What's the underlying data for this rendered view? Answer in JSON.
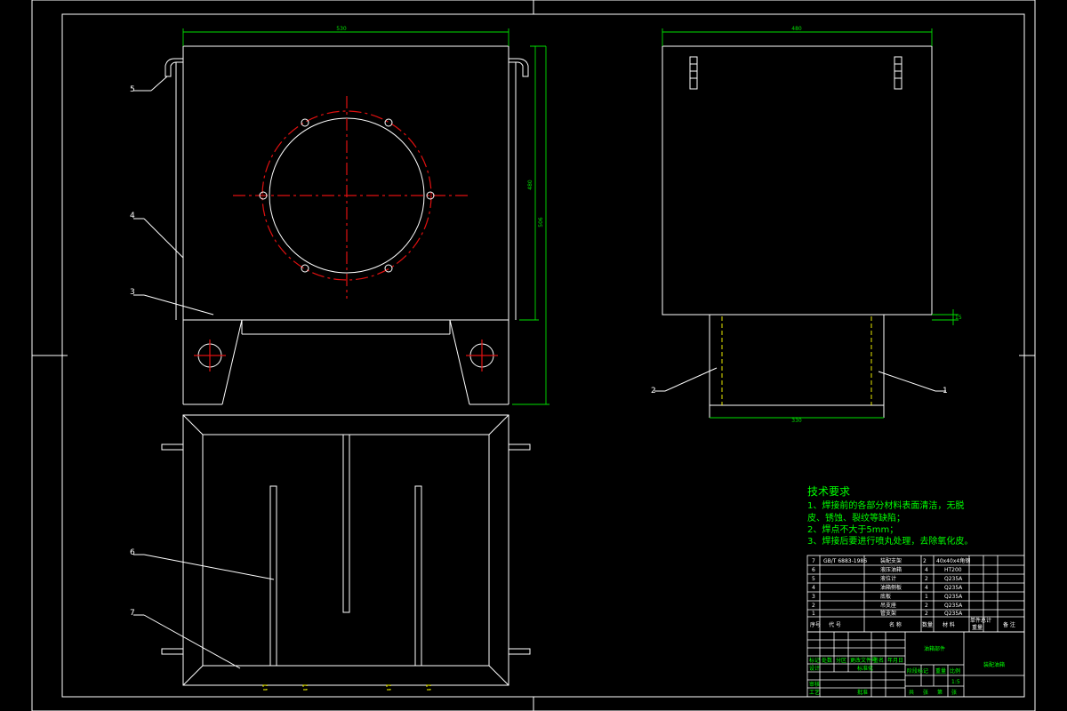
{
  "front_view": {
    "width_dim": "530",
    "height_inner_dim": "480",
    "height_outer_dim": "506",
    "callouts": [
      "5",
      "4",
      "3"
    ]
  },
  "side_view": {
    "width_dim": "480",
    "base_width_dim": "330",
    "small_dim": "15",
    "callouts": [
      "2",
      "1"
    ]
  },
  "top_view": {
    "callouts": [
      "6",
      "7"
    ]
  },
  "tech": {
    "title": "技术要求",
    "lines": [
      "1、焊接前的各部分材料表面清洁，无脱",
      "皮、锈蚀、裂纹等缺陷；",
      "2、焊点不大于5mm；",
      "3、焊接后要进行喷丸处理，去除氧化皮。"
    ]
  },
  "bom": {
    "rows": [
      {
        "no": "7",
        "code": "GB/T 6883-1986",
        "name": "装配支架",
        "qty": "2",
        "material": "40x40x4角钢"
      },
      {
        "no": "6",
        "code": "",
        "name": "液压油箱",
        "qty": "4",
        "material": "HT200"
      },
      {
        "no": "5",
        "code": "",
        "name": "液位计",
        "qty": "2",
        "material": "Q235A"
      },
      {
        "no": "4",
        "code": "",
        "name": "油箱侧板",
        "qty": "4",
        "material": "Q235A"
      },
      {
        "no": "3",
        "code": "",
        "name": "底板",
        "qty": "1",
        "material": "Q235A"
      },
      {
        "no": "2",
        "code": "",
        "name": "吊支座",
        "qty": "2",
        "material": "Q235A"
      },
      {
        "no": "1",
        "code": "",
        "name": "管支架",
        "qty": "2",
        "material": "Q235A"
      }
    ],
    "header": {
      "no": "序号",
      "code": "代 号",
      "name": "名 称",
      "qty": "数量",
      "material": "材 料",
      "weight": "单件总计",
      "unit_weight": "重量",
      "remark": "备 注"
    }
  },
  "titleblock": {
    "drawing_name": "油箱部件",
    "company": "装配油箱",
    "labels": [
      "标记",
      "处数",
      "分区",
      "更改文件号",
      "签名",
      "年月日",
      "设计",
      "标准化",
      "阶段标记",
      "重量",
      "比例",
      "审核",
      "工艺",
      "批准",
      "共",
      "张",
      "第",
      "张"
    ],
    "scale": "1:5"
  }
}
